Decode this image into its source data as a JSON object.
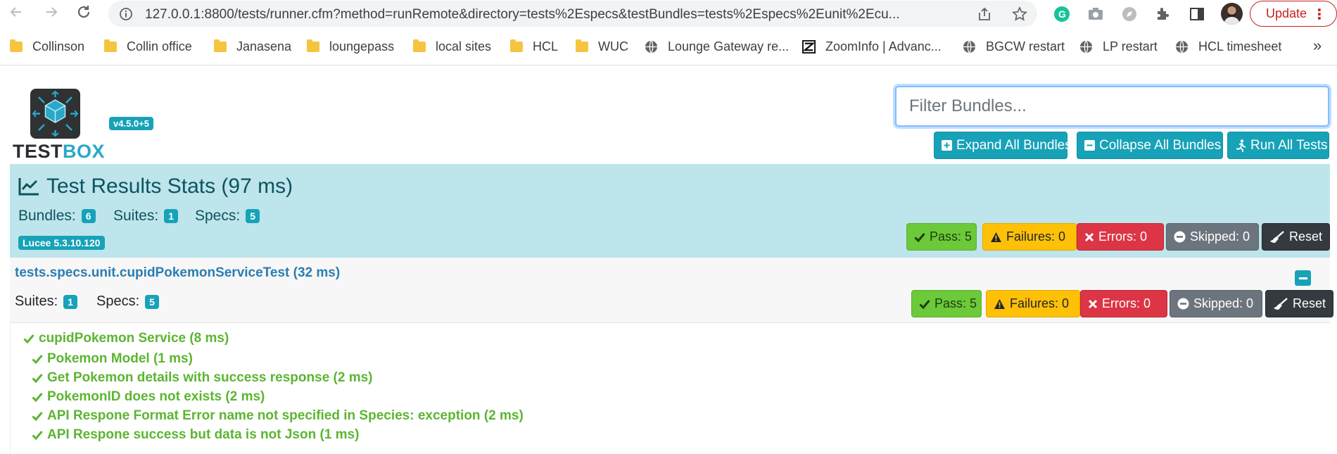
{
  "browser": {
    "url": "127.0.0.1:8800/tests/runner.cfm?method=runRemote&directory=tests%2Especs&testBundles=tests%2Especs%2Eunit%2Ecu...",
    "update_label": "Update",
    "bookmarks": [
      {
        "label": "Collinson",
        "icon": "folder-icon"
      },
      {
        "label": "Collin office",
        "icon": "folder-icon"
      },
      {
        "label": "Janasena",
        "icon": "folder-icon"
      },
      {
        "label": "loungepass",
        "icon": "folder-icon"
      },
      {
        "label": "local sites",
        "icon": "folder-icon"
      },
      {
        "label": "HCL",
        "icon": "folder-icon"
      },
      {
        "label": "WUC",
        "icon": "folder-icon"
      },
      {
        "label": "Lounge Gateway re...",
        "icon": "globe-icon"
      },
      {
        "label": "ZoomInfo | Advanc...",
        "icon": "zoominfo-icon"
      },
      {
        "label": "BGCW restart",
        "icon": "globe-icon"
      },
      {
        "label": "LP restart",
        "icon": "globe-icon"
      },
      {
        "label": "HCL timesheet",
        "icon": "globe-icon"
      }
    ],
    "more_label": "»"
  },
  "header": {
    "logo_text_a": "TEST",
    "logo_text_b": "BOX",
    "version": "v4.5.0+5",
    "filter_placeholder": "Filter Bundles...",
    "expand_label": "Expand All Bundles",
    "collapse_label": "Collapse All Bundles",
    "run_label": "Run All Tests"
  },
  "stats": {
    "title": "Test Results Stats (97 ms)",
    "bundles_label": "Bundles:",
    "bundles": "6",
    "suites_label": "Suites:",
    "suites": "1",
    "specs_label": "Specs:",
    "specs": "5",
    "engine": "Lucee 5.3.10.120",
    "pass": "Pass: 5",
    "failures": "Failures: 0",
    "errors": "Errors: 0",
    "skipped": "Skipped: 0",
    "reset": "Reset"
  },
  "bundle": {
    "name": "tests.specs.unit.cupidPokemonServiceTest",
    "duration": "(32 ms)",
    "suites_label": "Suites:",
    "suites": "1",
    "specs_label": "Specs:",
    "specs": "5",
    "pass": "Pass: 5",
    "failures": "Failures: 0",
    "errors": "Errors: 0",
    "skipped": "Skipped: 0",
    "reset": "Reset"
  },
  "suite": {
    "name": "cupidPokemon Service",
    "duration": "(8 ms)",
    "specs": [
      {
        "name": "Pokemon Model (1 ms)"
      },
      {
        "name": "Get Pokemon details with success response (2 ms)"
      },
      {
        "name": "PokemonID does not exists (2 ms)"
      },
      {
        "name": "API Respone Format Error name not specified in Species: exception (2 ms)"
      },
      {
        "name": "API Respone success but data is not Json (1 ms)"
      }
    ]
  },
  "colors": {
    "info": "#17a2b8",
    "info_bg": "#bee5eb",
    "pass": "#6cc93a",
    "warning": "#ffc107",
    "danger": "#dc3545",
    "secondary": "#6c757d",
    "dark": "#343a40",
    "spec_green": "#5cb531",
    "link": "#2a7db3"
  }
}
